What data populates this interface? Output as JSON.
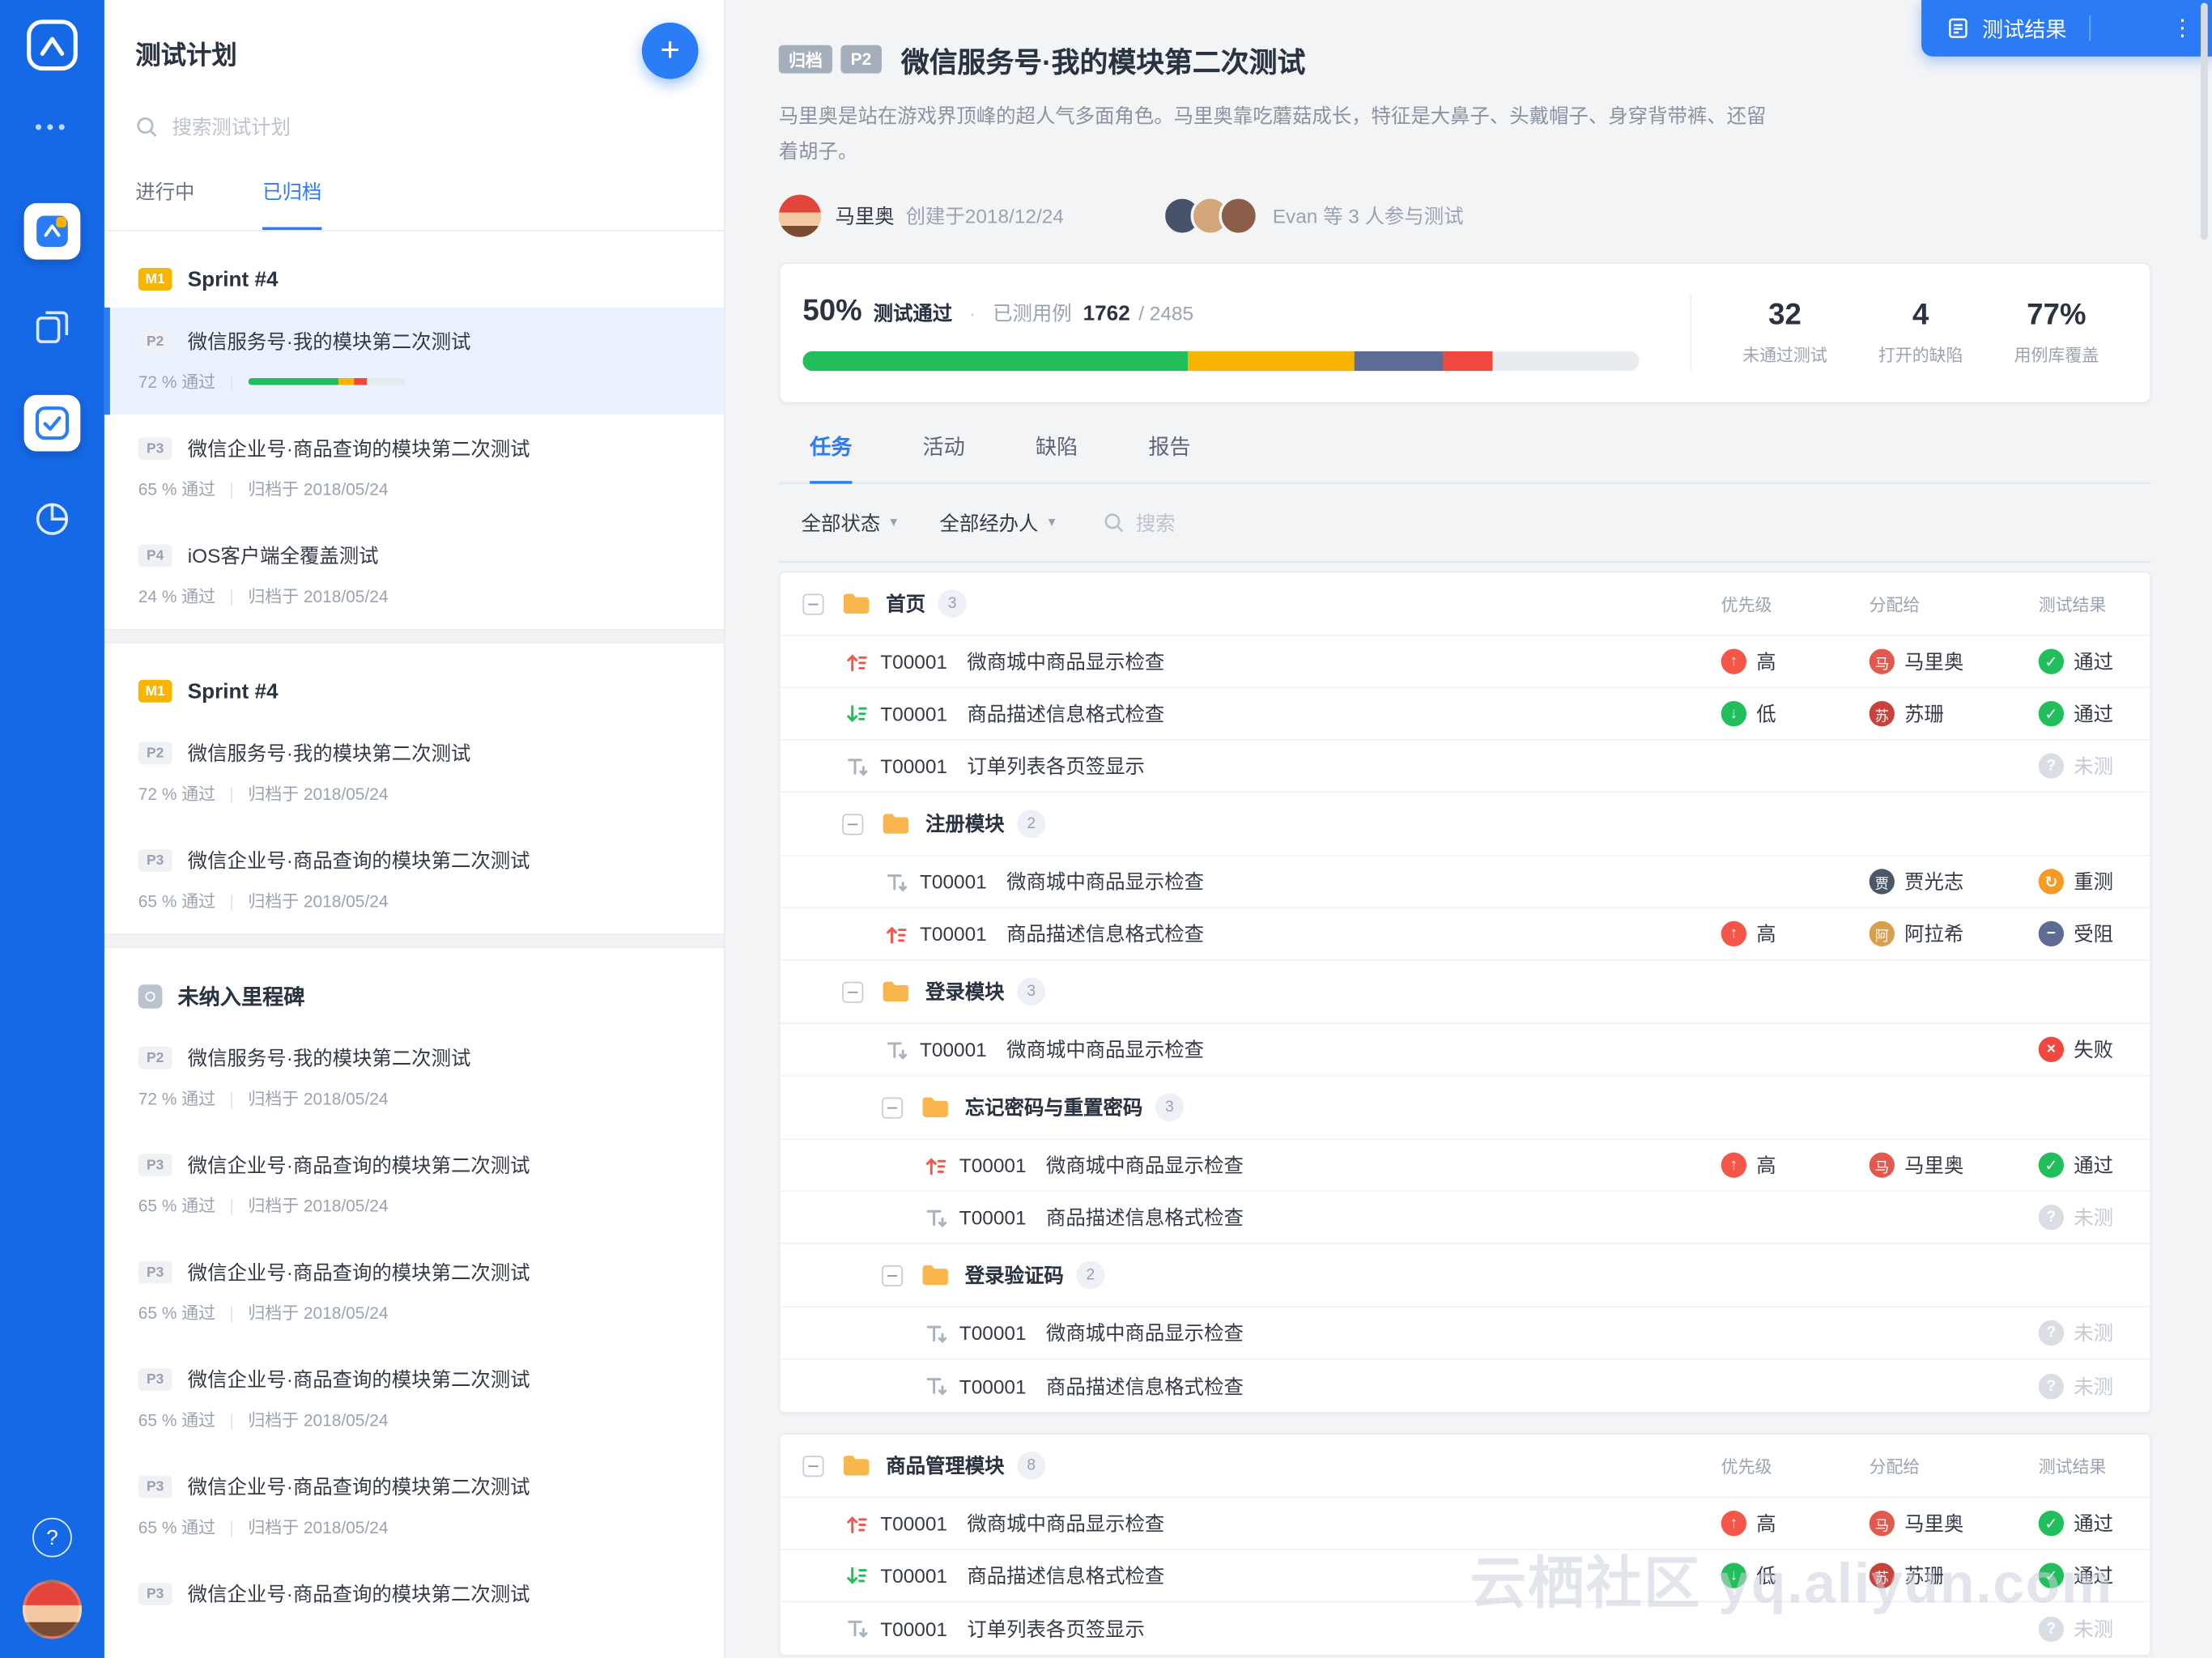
{
  "colors": {
    "accent_blue": "#2B7CF7",
    "rail_blue": "#1568E6",
    "green": "#22BE5C",
    "yellow": "#F7B500",
    "red": "#F0483E",
    "slate": "#5E6B94",
    "orange": "#F59A23"
  },
  "sidebar": {
    "title": "测试计划",
    "search_placeholder": "搜索测试计划",
    "tabs": [
      {
        "label": "进行中",
        "active": false
      },
      {
        "label": "已归档",
        "active": true
      }
    ],
    "groups": [
      {
        "badge": "M1",
        "title": "Sprint #4",
        "items": [
          {
            "priority": "P2",
            "title": "微信服务号·我的模块第二次测试",
            "pass": "72 % 通过",
            "selected": true,
            "progress": [
              {
                "color": "#22BE5C",
                "pct": 57
              },
              {
                "color": "#F7B500",
                "pct": 10
              },
              {
                "color": "#F0483E",
                "pct": 8
              },
              {
                "color": "#E8EBEF",
                "pct": 25
              }
            ]
          },
          {
            "priority": "P3",
            "title": "微信企业号·商品查询的模块第二次测试",
            "pass": "65 % 通过",
            "meta": "归档于 2018/05/24"
          },
          {
            "priority": "P4",
            "title": "iOS客户端全覆盖测试",
            "pass": "24 % 通过",
            "meta": "归档于 2018/05/24"
          }
        ]
      },
      {
        "badge": "M1",
        "title": "Sprint #4",
        "items": [
          {
            "priority": "P2",
            "title": "微信服务号·我的模块第二次测试",
            "pass": "72 % 通过",
            "meta": "归档于 2018/05/24"
          },
          {
            "priority": "P3",
            "title": "微信企业号·商品查询的模块第二次测试",
            "pass": "65 % 通过",
            "meta": "归档于 2018/05/24"
          }
        ]
      },
      {
        "milestone_icon": "milestone-icon",
        "title": "未纳入里程碑",
        "items": [
          {
            "priority": "P2",
            "title": "微信服务号·我的模块第二次测试",
            "pass": "72 % 通过",
            "meta": "归档于 2018/05/24"
          },
          {
            "priority": "P3",
            "title": "微信企业号·商品查询的模块第二次测试",
            "pass": "65 % 通过",
            "meta": "归档于 2018/05/24"
          },
          {
            "priority": "P3",
            "title": "微信企业号·商品查询的模块第二次测试",
            "pass": "65 % 通过",
            "meta": "归档于 2018/05/24"
          },
          {
            "priority": "P3",
            "title": "微信企业号·商品查询的模块第二次测试",
            "pass": "65 % 通过",
            "meta": "归档于 2018/05/24"
          },
          {
            "priority": "P3",
            "title": "微信企业号·商品查询的模块第二次测试",
            "pass": "65 % 通过",
            "meta": "归档于 2018/05/24"
          },
          {
            "priority": "P3",
            "title": "微信企业号·商品查询的模块第二次测试"
          }
        ]
      }
    ]
  },
  "header": {
    "badges": [
      "归档",
      "P2"
    ],
    "title": "微信服务号·我的模块第二次测试",
    "description": "马里奥是站在游戏界顶峰的超人气多面角色。马里奥靠吃蘑菇成长，特征是大鼻子、头戴帽子、身穿背带裤、还留着胡子。",
    "creator_name": "马里奥",
    "creator_meta": "创建于2018/12/24",
    "participants": "Evan 等 3 人参与测试",
    "participant_avatars": [
      {
        "color": "#46536B"
      },
      {
        "color": "#D2A679"
      },
      {
        "color": "#8B5E4A"
      }
    ],
    "action_label": "测试结果"
  },
  "summary": {
    "percent": "50%",
    "percent_label": "测试通过",
    "dot": "·",
    "tested_label": "已测用例",
    "tested_value": "1762",
    "tested_total": "/ 2485",
    "bar": [
      {
        "color": "#22BE5C",
        "pct": 46
      },
      {
        "color": "#F7B500",
        "pct": 20
      },
      {
        "color": "#5E6B94",
        "pct": 10.5
      },
      {
        "color": "#F0483E",
        "pct": 6
      }
    ],
    "stats": [
      {
        "value": "32",
        "label": "未通过测试"
      },
      {
        "value": "4",
        "label": "打开的缺陷"
      },
      {
        "value": "77%",
        "label": "用例库覆盖"
      }
    ]
  },
  "tabs": [
    {
      "label": "任务",
      "active": true
    },
    {
      "label": "活动",
      "active": false
    },
    {
      "label": "缺陷",
      "active": false
    },
    {
      "label": "报告",
      "active": false
    }
  ],
  "filters": {
    "status": "全部状态",
    "assignee": "全部经办人",
    "search_placeholder": "搜索"
  },
  "columns": {
    "priority": "优先级",
    "assignee": "分配给",
    "result": "测试结果"
  },
  "tree": {
    "cards": [
      {
        "nodes": [
          {
            "type": "group",
            "depth": 0,
            "name": "首页",
            "count": "3",
            "columns": true
          },
          {
            "type": "task",
            "depth": 0,
            "icon": "arrow-up",
            "id": "T00001",
            "title": "微商城中商品显示检查",
            "priority": {
              "kind": "high",
              "label": "高"
            },
            "assignee": {
              "name": "马里奥",
              "initial": "马",
              "color": "#E25A4E"
            },
            "result": {
              "kind": "pass",
              "label": "通过"
            }
          },
          {
            "type": "task",
            "depth": 0,
            "icon": "arrow-down",
            "id": "T00001",
            "title": "商品描述信息格式检查",
            "priority": {
              "kind": "low",
              "label": "低"
            },
            "assignee": {
              "name": "苏珊",
              "initial": "苏",
              "color": "#C8433B"
            },
            "result": {
              "kind": "pass",
              "label": "通过"
            }
          },
          {
            "type": "task",
            "depth": 0,
            "icon": "text",
            "id": "T00001",
            "title": "订单列表各页签显示",
            "result": {
              "kind": "untested",
              "label": "未测"
            }
          },
          {
            "type": "group",
            "depth": 1,
            "name": "注册模块",
            "count": "2"
          },
          {
            "type": "task",
            "depth": 1,
            "icon": "text",
            "id": "T00001",
            "title": "微商城中商品显示检查",
            "assignee": {
              "name": "贾光志",
              "initial": "贾",
              "color": "#4C5868"
            },
            "result": {
              "kind": "retest",
              "label": "重测"
            }
          },
          {
            "type": "task",
            "depth": 1,
            "icon": "arrow-up",
            "id": "T00001",
            "title": "商品描述信息格式检查",
            "priority": {
              "kind": "high",
              "label": "高"
            },
            "assignee": {
              "name": "阿拉希",
              "initial": "阿",
              "color": "#D9A04C"
            },
            "result": {
              "kind": "blocked",
              "label": "受阻"
            }
          },
          {
            "type": "group",
            "depth": 1,
            "name": "登录模块",
            "count": "3"
          },
          {
            "type": "task",
            "depth": 1,
            "icon": "text",
            "id": "T00001",
            "title": "微商城中商品显示检查",
            "result": {
              "kind": "fail",
              "label": "失败"
            }
          },
          {
            "type": "group",
            "depth": 2,
            "name": "忘记密码与重置密码",
            "count": "3"
          },
          {
            "type": "task",
            "depth": 2,
            "icon": "arrow-up",
            "id": "T00001",
            "title": "微商城中商品显示检查",
            "priority": {
              "kind": "high",
              "label": "高"
            },
            "assignee": {
              "name": "马里奥",
              "initial": "马",
              "color": "#E25A4E"
            },
            "result": {
              "kind": "pass",
              "label": "通过"
            }
          },
          {
            "type": "task",
            "depth": 2,
            "icon": "text",
            "id": "T00001",
            "title": "商品描述信息格式检查",
            "result": {
              "kind": "untested",
              "label": "未测"
            }
          },
          {
            "type": "group",
            "depth": 2,
            "name": "登录验证码",
            "count": "2"
          },
          {
            "type": "task",
            "depth": 2,
            "icon": "text",
            "id": "T00001",
            "title": "微商城中商品显示检查",
            "result": {
              "kind": "untested",
              "label": "未测"
            }
          },
          {
            "type": "task",
            "depth": 2,
            "icon": "text",
            "id": "T00001",
            "title": "商品描述信息格式检查",
            "result": {
              "kind": "untested",
              "label": "未测"
            }
          }
        ]
      },
      {
        "nodes": [
          {
            "type": "group",
            "depth": 0,
            "name": "商品管理模块",
            "count": "8",
            "columns": true
          },
          {
            "type": "task",
            "depth": 0,
            "icon": "arrow-up",
            "id": "T00001",
            "title": "微商城中商品显示检查",
            "priority": {
              "kind": "high",
              "label": "高"
            },
            "assignee": {
              "name": "马里奥",
              "initial": "马",
              "color": "#E25A4E"
            },
            "result": {
              "kind": "pass",
              "label": "通过"
            }
          },
          {
            "type": "task",
            "depth": 0,
            "icon": "arrow-down",
            "id": "T00001",
            "title": "商品描述信息格式检查",
            "priority": {
              "kind": "low",
              "label": "低"
            },
            "assignee": {
              "name": "苏珊",
              "initial": "苏",
              "color": "#C8433B"
            },
            "result": {
              "kind": "pass",
              "label": "通过"
            }
          },
          {
            "type": "task",
            "depth": 0,
            "icon": "text",
            "id": "T00001",
            "title": "订单列表各页签显示",
            "result": {
              "kind": "untested",
              "label": "未测"
            }
          }
        ]
      }
    ]
  },
  "watermark": "云栖社区 yq.aliyun.com"
}
